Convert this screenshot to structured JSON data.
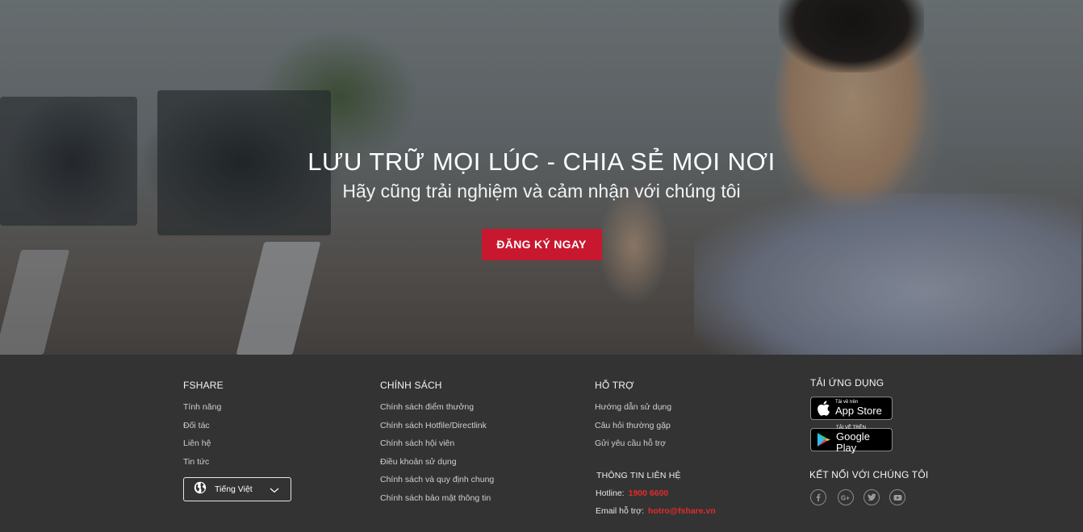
{
  "hero": {
    "title": "LƯU TRỮ MỌI LÚC - CHIA SẺ MỌI NƠI",
    "subtitle": "Hãy cũng trải nghiệm và cảm nhận với chúng tôi",
    "cta_label": "ĐĂNG KÝ NGAY"
  },
  "footer": {
    "fshare": {
      "title": "FSHARE",
      "links": [
        "Tính năng",
        "Đối tác",
        "Liên hệ",
        "Tin tức"
      ]
    },
    "language": {
      "label": "Tiếng Việt",
      "icon": "globe-icon"
    },
    "policy": {
      "title": "CHÍNH SÁCH",
      "links": [
        "Chính sách điểm thưởng",
        "Chính sách Hotfile/Directlink",
        "Chính sách hội viên",
        "Điều khoản sử dụng",
        "Chính sách và quy định chung",
        "Chính sách bảo mật thông tin"
      ]
    },
    "support": {
      "title": "HỖ TRỢ",
      "links": [
        "Hướng dẫn sử dụng",
        "Câu hỏi thường gặp",
        "Gửi yêu cầu hỗ trợ"
      ]
    },
    "contact": {
      "title": "THÔNG TIN LIÊN HỆ",
      "hotline_label": "Hotline:",
      "hotline": "1900 6600",
      "email_label": "Email hỗ trợ:",
      "email": "hotro@fshare.vn"
    },
    "apps": {
      "title": "TẢI ỨNG DỤNG",
      "app_store_small": "Tải về trên",
      "app_store_big": "App Store",
      "google_play_small": "TẢI VỀ TRÊN",
      "google_play_big": "Google Play"
    },
    "social": {
      "title": "KẾT NỐI VỚI CHÚNG TÔI",
      "icons": [
        "facebook-icon",
        "google-plus-icon",
        "twitter-icon",
        "youtube-icon"
      ]
    }
  },
  "colors": {
    "accent": "#c8182f",
    "footer_bg": "#333333",
    "link_red": "#e32b2b"
  }
}
